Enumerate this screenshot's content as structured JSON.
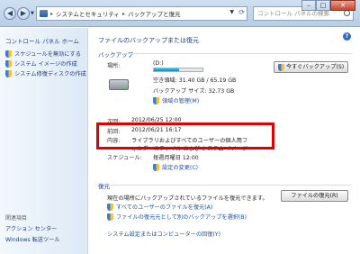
{
  "window": {
    "breadcrumbs": [
      "システムとセキュリティ",
      "バックアップと復元"
    ],
    "search_placeholder": "コントロール パネルの検索",
    "controls": {
      "minimize": "–",
      "maximize": "□",
      "close": "✕"
    }
  },
  "sidebar": {
    "home": "コントロール パネル ホーム",
    "items": [
      {
        "label": "スケジュールを無効にする",
        "icon": "shield-icon"
      },
      {
        "label": "システム イメージの作成",
        "icon": "shield-icon"
      },
      {
        "label": "システム修復ディスクの作成",
        "icon": "shield-icon"
      }
    ],
    "related_heading": "関連項目",
    "related": [
      {
        "label": "アクション センター"
      },
      {
        "label": "Windows 転送ツール"
      }
    ]
  },
  "main": {
    "title": "ファイルのバックアップまたは復元",
    "backup_heading": "バックアップ",
    "location_label": "場所:",
    "location_value": "(D:)",
    "disk_used_fraction": 0.52,
    "free_space": "空き領域: 31.40 GB / 65.19 GB",
    "backup_size": "バックアップ サイズ: 32.73 GB",
    "manage_space": "領域の管理(M)",
    "backup_now": "今すぐバックアップ(S)",
    "next_label": "次回:",
    "next_value": "2012/06/25 12:00",
    "last_label": "前回:",
    "last_value": "2012/06/21 16:17",
    "contents_label": "内容:",
    "contents_value_1": "ライブラリおよびすべてのユーザーの個人用フ",
    "contents_value_2": "ォルダーのファイル および システム イメージ",
    "schedule_label": "スケジュール:",
    "schedule_value": "毎週月曜日 12:00",
    "change_settings": "設定の変更(C)",
    "restore_heading": "復元",
    "restore_desc": "現在の場所にバックアップされているファイルを復元できます。",
    "restore_files": "ファイルの復元(R)",
    "restore_all_users": "すべてのユーザーのファイルを復元(A)",
    "select_other_backup": "ファイルの復元元として別のバックアップを選択(B)",
    "recover_link": "システム設定またはコンピューターの回復(Y)"
  }
}
